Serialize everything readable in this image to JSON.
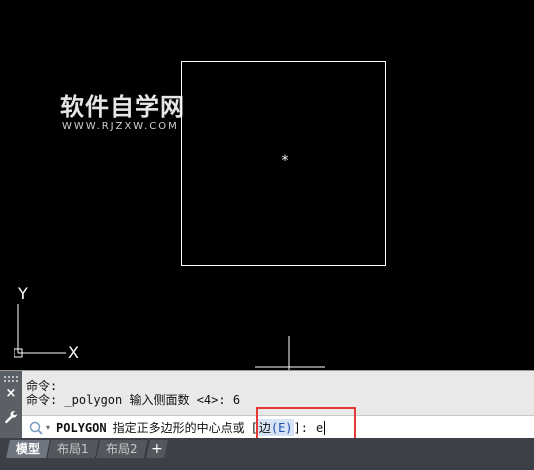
{
  "canvas": {
    "center_marker": "*",
    "watermark": {
      "title": "软件自学网",
      "url": "WWW.RJZXW.COM"
    },
    "ucs": {
      "x_label": "X",
      "y_label": "Y"
    }
  },
  "command_line": {
    "history": [
      "命令:",
      "命令: _polygon 输入侧面数 <4>: 6"
    ],
    "input": {
      "command_name": "POLYGON",
      "prompt": "指定正多边形的中心点或",
      "option_open": "[",
      "option_label": "边",
      "option_key": "(E)",
      "option_close": "]:",
      "typed_value": "e"
    },
    "icons": {
      "close": "×",
      "search": "search-icon",
      "dropdown": "▾",
      "customize": "wrench-icon"
    }
  },
  "layout_tabs": {
    "items": [
      {
        "label": "模型",
        "active": true
      },
      {
        "label": "布局1",
        "active": false
      },
      {
        "label": "布局2",
        "active": false
      }
    ],
    "add_label": "+"
  },
  "colors": {
    "canvas_bg": "#000000",
    "entity": "#ffffff",
    "annotation_box": "#e53935",
    "command_bg": "#e9e9e9"
  }
}
